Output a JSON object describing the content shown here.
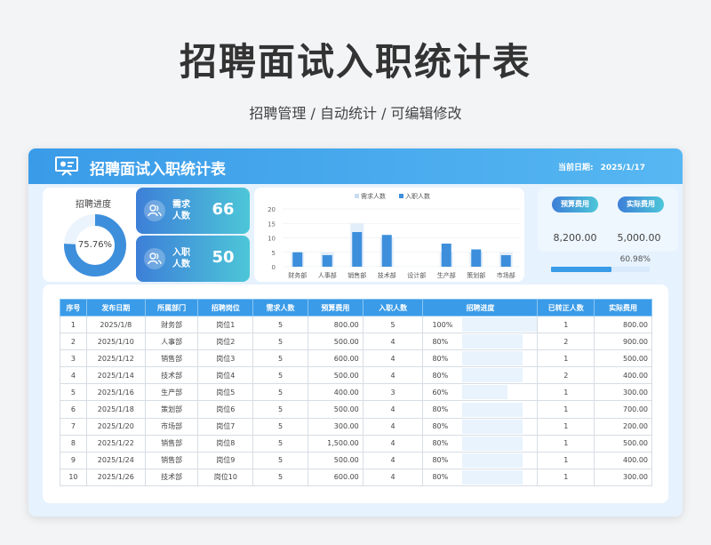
{
  "page": {
    "title": "招聘面试入职统计表",
    "subtitle": "招聘管理 / 自动统计 / 可编辑修改"
  },
  "header": {
    "title": "招聘面试入职统计表",
    "date_label": "当前日期:",
    "date_value": "2025/1/17"
  },
  "progress": {
    "label": "招聘进度",
    "value_text": "75.76%",
    "value": 0.7576
  },
  "stats": {
    "demand": {
      "label": "需求人数",
      "value": "66"
    },
    "hired": {
      "label": "入职人数",
      "value": "50"
    }
  },
  "cost": {
    "budget": {
      "label": "预算费用",
      "value": "8,200.00"
    },
    "actual": {
      "label": "实际费用",
      "value": "5,000.00"
    },
    "ratio_text": "60.98%",
    "ratio": 0.6098
  },
  "chart_data": {
    "type": "bar",
    "categories": [
      "财务部",
      "人事部",
      "销售部",
      "技术部",
      "设计部",
      "生产部",
      "策划部",
      "市场部"
    ],
    "series": [
      {
        "name": "需求人数",
        "values": [
          5,
          5,
          15,
          10,
          0,
          5,
          5,
          5
        ],
        "color": "#e3eefb"
      },
      {
        "name": "入职人数",
        "values": [
          5,
          4,
          12,
          11,
          0,
          8,
          6,
          4
        ],
        "color": "#3d8fdc"
      }
    ],
    "ylim": [
      0,
      20
    ],
    "yticks": [
      "0",
      "5",
      "10",
      "15",
      "20"
    ],
    "legend": "top"
  },
  "table": {
    "headers": [
      "序号",
      "发布日期",
      "所属部门",
      "招聘岗位",
      "需求人数",
      "预算费用",
      "入职人数",
      "招聘进度",
      "已转正人数",
      "实际费用"
    ],
    "rows": [
      [
        "1",
        "2025/1/8",
        "财务部",
        "岗位1",
        "5",
        "800.00",
        "5",
        "100%",
        "1",
        "800.00"
      ],
      [
        "2",
        "2025/1/10",
        "人事部",
        "岗位2",
        "5",
        "500.00",
        "4",
        "80%",
        "2",
        "900.00"
      ],
      [
        "3",
        "2025/1/12",
        "销售部",
        "岗位3",
        "5",
        "600.00",
        "4",
        "80%",
        "1",
        "500.00"
      ],
      [
        "4",
        "2025/1/14",
        "技术部",
        "岗位4",
        "5",
        "500.00",
        "4",
        "80%",
        "2",
        "400.00"
      ],
      [
        "5",
        "2025/1/16",
        "生产部",
        "岗位5",
        "5",
        "400.00",
        "3",
        "60%",
        "1",
        "300.00"
      ],
      [
        "6",
        "2025/1/18",
        "策划部",
        "岗位6",
        "5",
        "500.00",
        "4",
        "80%",
        "1",
        "700.00"
      ],
      [
        "7",
        "2025/1/20",
        "市场部",
        "岗位7",
        "5",
        "300.00",
        "4",
        "80%",
        "1",
        "200.00"
      ],
      [
        "8",
        "2025/1/22",
        "销售部",
        "岗位8",
        "5",
        "1,500.00",
        "4",
        "80%",
        "1",
        "500.00"
      ],
      [
        "9",
        "2025/1/24",
        "销售部",
        "岗位9",
        "5",
        "500.00",
        "4",
        "80%",
        "1",
        "400.00"
      ],
      [
        "10",
        "2025/1/26",
        "技术部",
        "岗位10",
        "5",
        "600.00",
        "4",
        "80%",
        "1",
        "300.00"
      ]
    ],
    "progress_values": [
      1.0,
      0.8,
      0.8,
      0.8,
      0.6,
      0.8,
      0.8,
      0.8,
      0.8,
      0.8
    ]
  }
}
